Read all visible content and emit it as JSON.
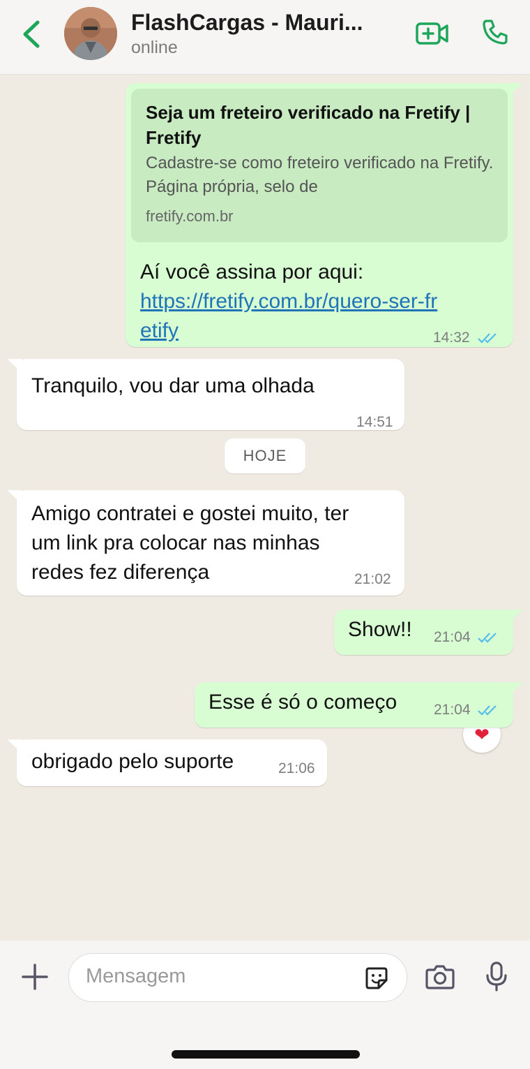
{
  "header": {
    "back_icon": "chevron-left-icon",
    "contact_name": "FlashCargas - Mauri...",
    "status": "online",
    "video_icon": "video-add-icon",
    "call_icon": "phone-icon"
  },
  "colors": {
    "accent": "#1da65a",
    "outgoing_bubble": "#d9fdd3",
    "incoming_bubble": "#ffffff",
    "chat_bg": "#efeae2",
    "link": "#1f74b8",
    "read_ticks": "#53bdeb"
  },
  "messages": {
    "m1": {
      "preview_title": "Seja um freteiro verificado na Fretify | Fretify",
      "preview_desc": "Cadastre-se como freteiro verificado na Fretify. Página própria, selo de",
      "preview_domain": "fretify.com.br",
      "text": "Aí você assina por aqui:",
      "link_part1": "https://fretify.com.br/quero-ser-fr",
      "link_part2": "etify",
      "time": "14:32"
    },
    "m2": {
      "text": "Tranquilo, vou dar uma olhada",
      "time": "14:51"
    },
    "day_chip": "HOJE",
    "m3": {
      "line1": "Amigo contratei e gostei muito, ter",
      "line2": "um link pra colocar nas minhas",
      "line3": "redes fez diferença",
      "time": "21:02"
    },
    "m4": {
      "text": "Show!!",
      "time": "21:04",
      "reaction": "❤"
    },
    "m5": {
      "text": "Esse é só o começo",
      "time": "21:04"
    },
    "m6": {
      "text": "obrigado pelo suporte",
      "time": "21:06"
    }
  },
  "composer": {
    "placeholder": "Mensagem",
    "plus_icon": "plus-icon",
    "sticker_icon": "sticker-icon",
    "camera_icon": "camera-icon",
    "mic_icon": "microphone-icon"
  }
}
